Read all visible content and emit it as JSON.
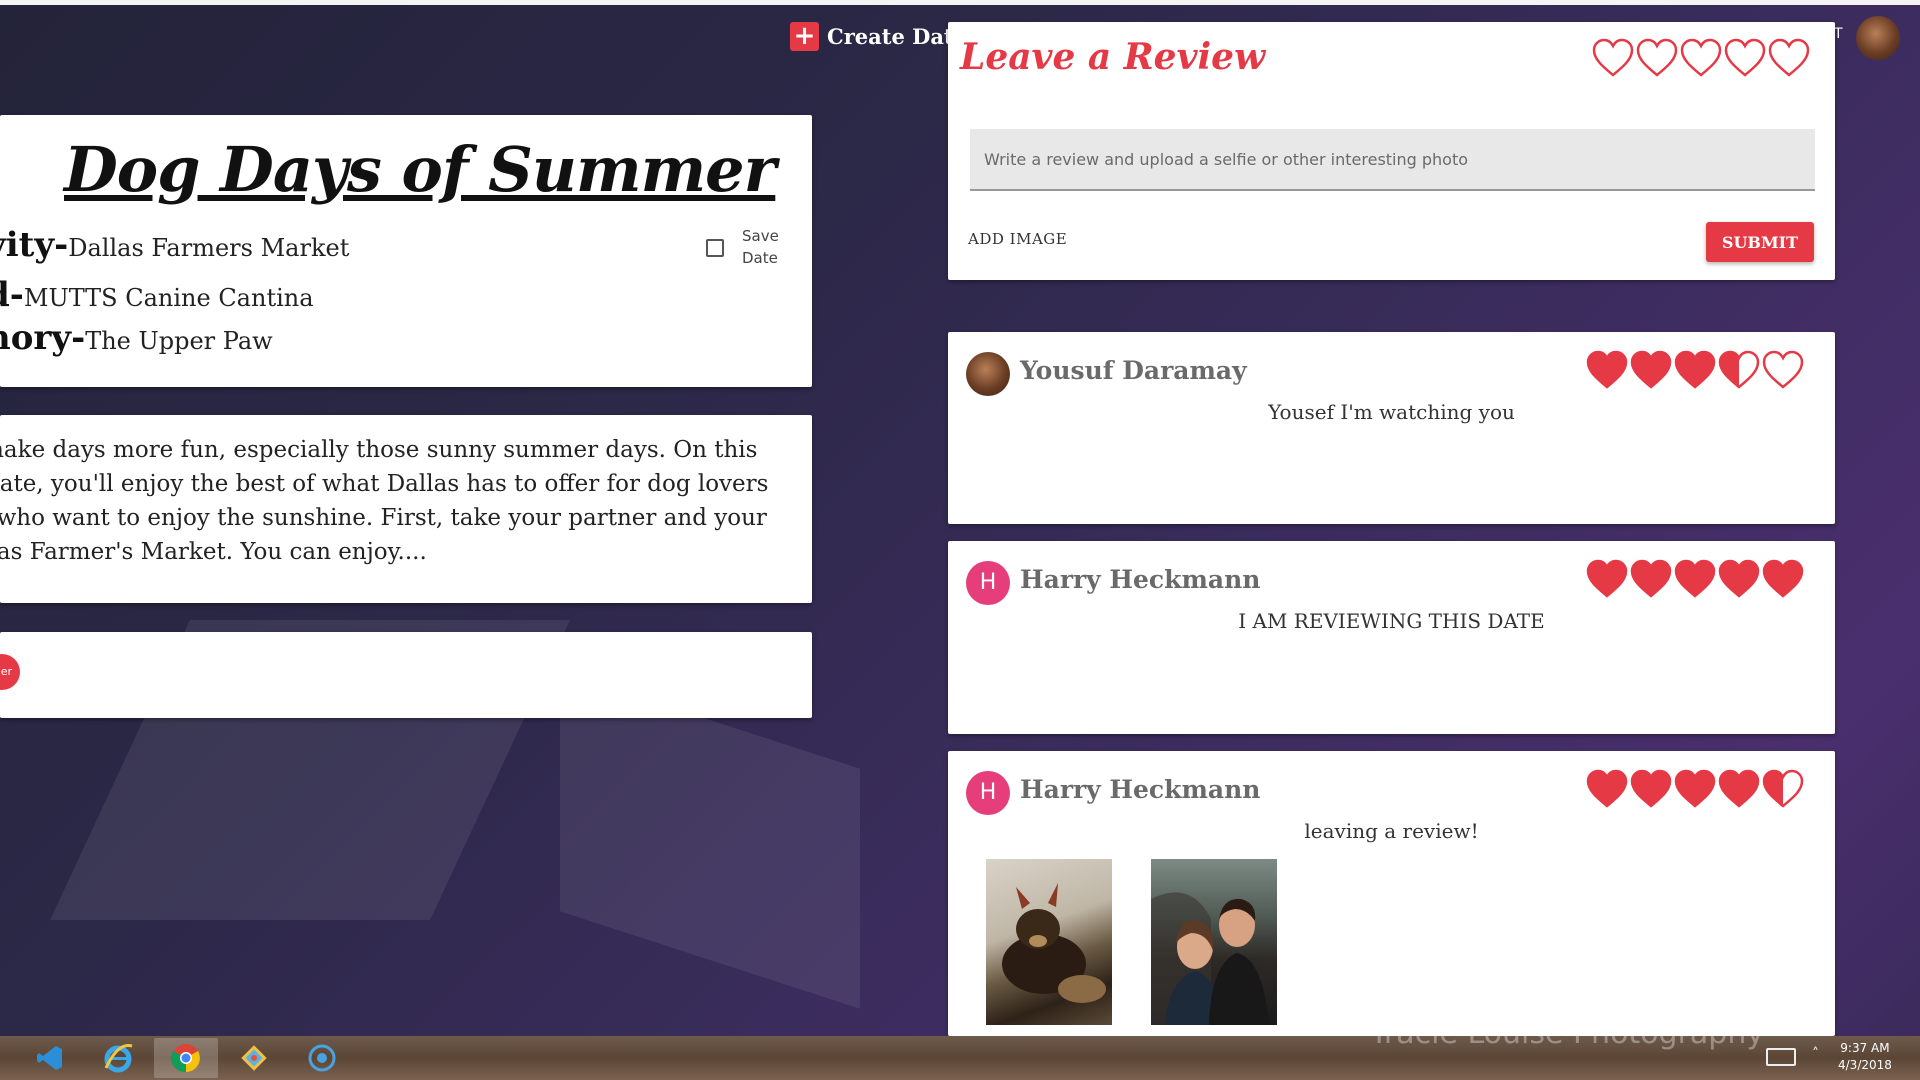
{
  "nav": {
    "create_date_label": "Create Date",
    "right_fragment": "T"
  },
  "date": {
    "title": "Dog Days of Summer",
    "rows": [
      {
        "key": "vity-",
        "value": "Dallas Farmers Market"
      },
      {
        "key": "d-",
        "value": "MUTTS Canine Cantina"
      },
      {
        "key": "nory-",
        "value": "The Upper Paw"
      }
    ],
    "save_label_line1": "Save",
    "save_label_line2": "Date",
    "description_lines": [
      "ys make days more fun, especially those sunny summer days. On this",
      "lly date, you'll enjoy the best of what Dallas has to offer for dog lovers",
      "ose who want to enjoy the sunshine. First, take your partner and your",
      " Dallas Farmer's Market. You can enjoy...."
    ],
    "tag_fragment": "er"
  },
  "review_form": {
    "title": "Leave a Review",
    "rating": 0,
    "placeholder": "Write a review and upload a selfie or other interesting photo",
    "add_image_label": "ADD IMAGE",
    "submit_label": "SUBMIT"
  },
  "reviews": [
    {
      "name": "Yousuf Daramay",
      "avatar": "photo",
      "avatar_letter": "",
      "rating": 3.5,
      "text": "Yousef I'm watching you",
      "photos": []
    },
    {
      "name": "Harry Heckmann",
      "avatar": "letter",
      "avatar_letter": "H",
      "rating": 5,
      "text": "I AM REVIEWING THIS DATE",
      "photos": []
    },
    {
      "name": "Harry Heckmann",
      "avatar": "letter",
      "avatar_letter": "H",
      "rating": 4.5,
      "text": "leaving a review!",
      "photos": [
        "dog-photo",
        "couple-photo"
      ]
    }
  ],
  "colors": {
    "accent": "#e53946",
    "heart": "#e53946",
    "avatar_h": "#e53e7a"
  },
  "taskbar": {
    "apps": [
      "vscode-icon",
      "ie-icon",
      "chrome-icon",
      "git-icon",
      "app-icon"
    ],
    "watermark": "Tracie Louise Photography",
    "time": "9:37 AM",
    "date": "4/3/2018"
  }
}
